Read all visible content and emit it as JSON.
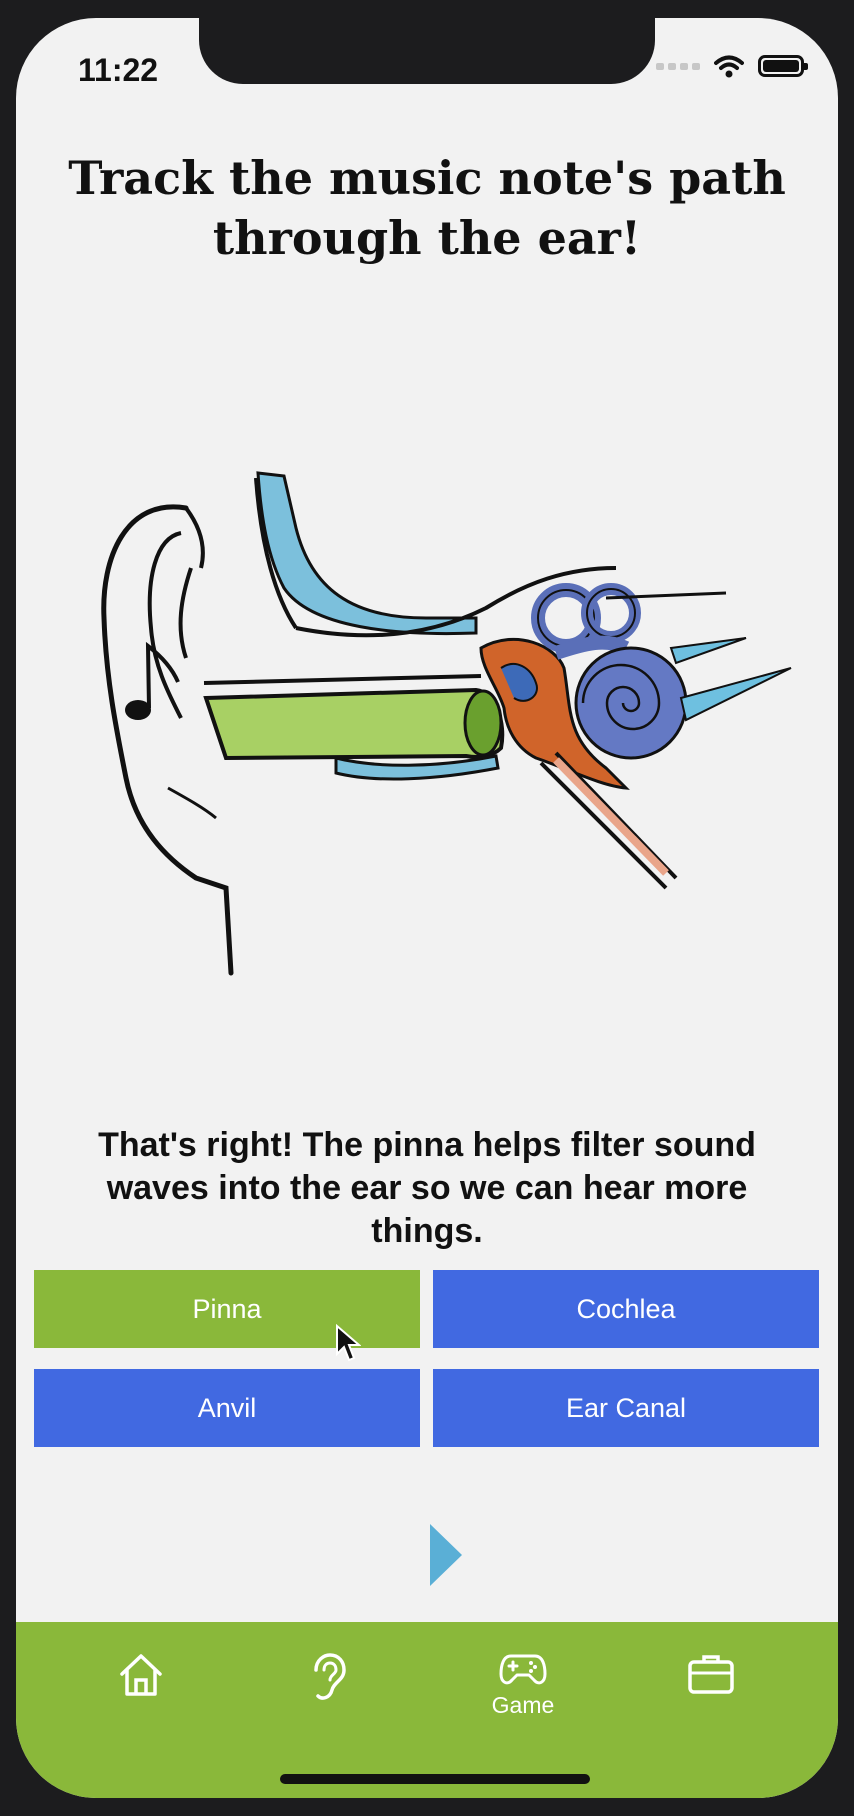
{
  "status_bar": {
    "time": "11:22"
  },
  "title": "Track the music note's path through the ear!",
  "feedback": "That's right! The pinna helps filter sound waves into the ear so we can hear more things.",
  "answers": [
    {
      "label": "Pinna",
      "state": "correct",
      "color": "#8ab83a"
    },
    {
      "label": "Cochlea",
      "state": "default",
      "color": "#4169e1"
    },
    {
      "label": "Anvil",
      "state": "default",
      "color": "#4169e1"
    },
    {
      "label": "Ear Canal",
      "state": "default",
      "color": "#4169e1"
    }
  ],
  "tabbar": {
    "background": "#8ab83a",
    "tabs": [
      {
        "icon": "home-icon",
        "label": ""
      },
      {
        "icon": "ear-icon",
        "label": ""
      },
      {
        "icon": "gamepad-icon",
        "label": "Game",
        "active": true
      },
      {
        "icon": "briefcase-icon",
        "label": ""
      }
    ]
  },
  "colors": {
    "accent_green": "#8ab83a",
    "button_blue": "#4169e1",
    "next_arrow": "#5aafd6"
  }
}
